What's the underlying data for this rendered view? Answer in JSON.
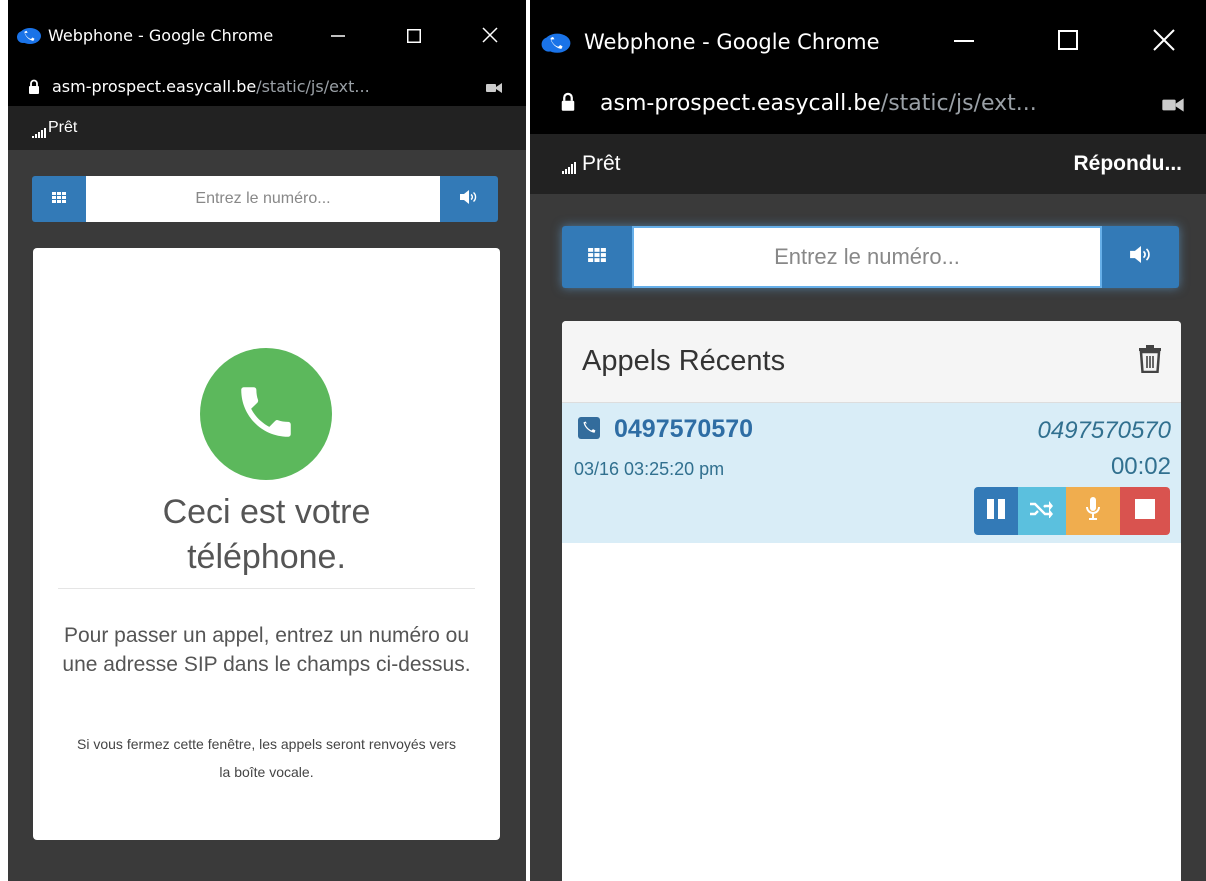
{
  "left_window": {
    "title": "Webphone - Google Chrome",
    "url_host": "asm-prospect.easycall.be",
    "url_path": "/static/js/ext...",
    "status": "Prêt",
    "dial_placeholder": "Entrez le numéro...",
    "heading": "Ceci est votre téléphone.",
    "instructions": "Pour passer un appel, entrez un numéro ou une adresse SIP dans le champs ci-dessus.",
    "note": "Si vous fermez cette fenêtre, les appels seront renvoyés vers la boîte vocale."
  },
  "right_window": {
    "title": "Webphone - Google Chrome",
    "url_host": "asm-prospect.easycall.be",
    "url_path": "/static/js/ext...",
    "status": "Prêt",
    "call_status": "Répondu...",
    "dial_placeholder": "Entrez le numéro...",
    "recent_title": "Appels Récents",
    "recent_calls": [
      {
        "number": "0497570570",
        "name": "0497570570",
        "datetime": "03/16 03:25:20 pm",
        "duration": "00:02"
      }
    ]
  },
  "icons": {
    "app": "webphone-cloud-icon",
    "lock": "lock-icon",
    "camera": "camera-icon",
    "keypad": "keypad-icon",
    "speaker": "speaker-icon",
    "phone": "phone-icon",
    "trash": "trash-icon",
    "pause": "pause-icon",
    "transfer": "transfer-icon",
    "mic": "microphone-icon",
    "hangup": "stop-icon"
  },
  "colors": {
    "primary": "#337ab7",
    "success": "#5cb85c",
    "info": "#5bc0de",
    "warning": "#f0ad4e",
    "danger": "#d9534f",
    "active_row": "#d9edf7"
  }
}
